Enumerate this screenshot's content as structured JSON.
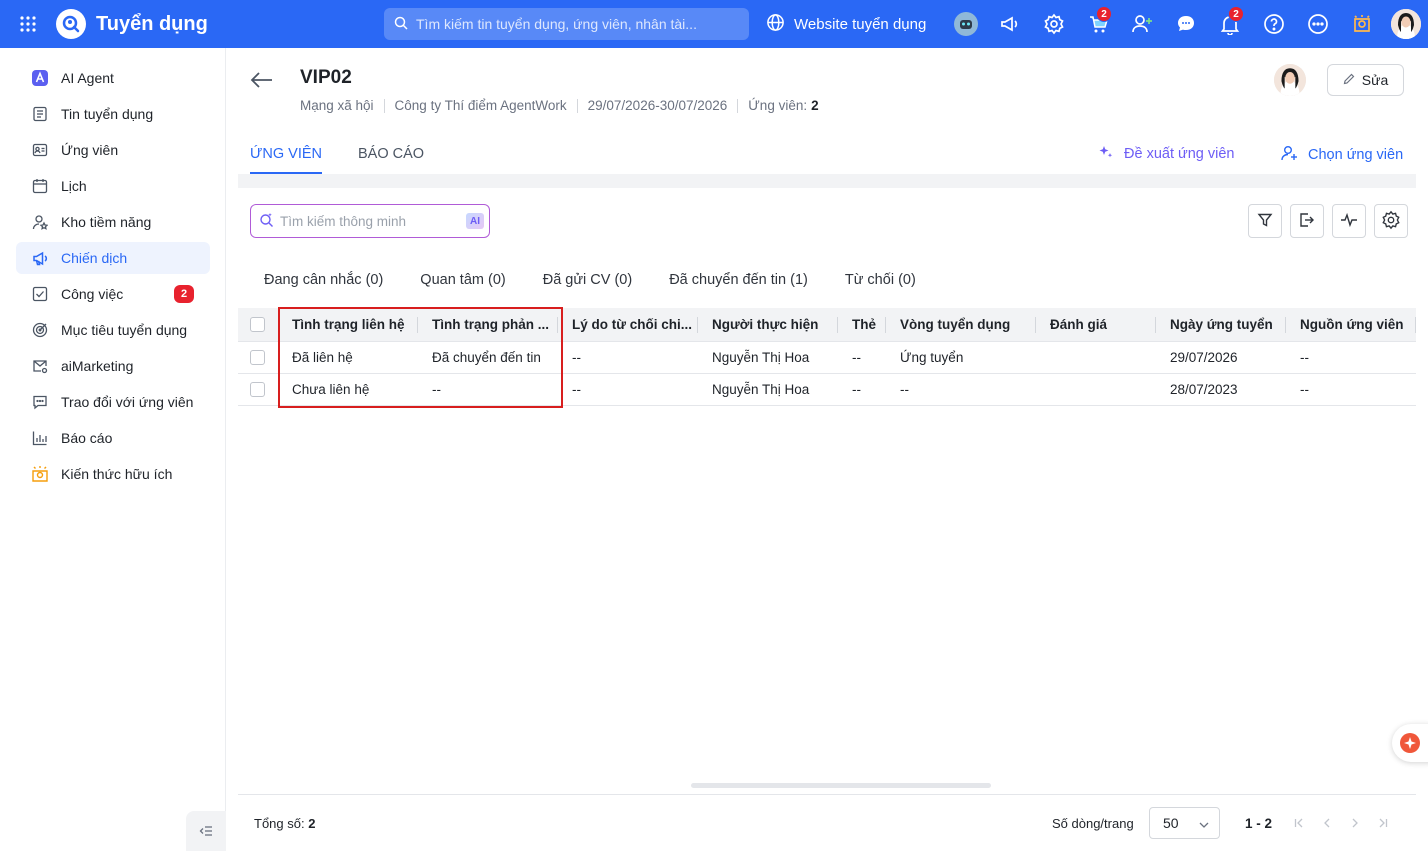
{
  "app": {
    "title": "Tuyển dụng"
  },
  "search": {
    "placeholder": "Tìm kiếm tin tuyển dụng, ứng viên, nhân tài..."
  },
  "topbar": {
    "website_label": "Website tuyển dụng",
    "cart_badge": "2",
    "notification_badge": "2"
  },
  "sidebar": {
    "items": [
      {
        "label": "AI Agent",
        "icon": "ai-agent-icon"
      },
      {
        "label": "Tin tuyển dụng",
        "icon": "document-icon"
      },
      {
        "label": "Ứng viên",
        "icon": "id-card-icon"
      },
      {
        "label": "Lịch",
        "icon": "calendar-icon"
      },
      {
        "label": "Kho tiềm năng",
        "icon": "user-star-icon"
      },
      {
        "label": "Chiến dịch",
        "icon": "megaphone-icon",
        "active": true
      },
      {
        "label": "Công việc",
        "icon": "checkbox-icon",
        "badge": "2"
      },
      {
        "label": "Mục tiêu tuyển dụng",
        "icon": "target-icon"
      },
      {
        "label": "aiMarketing",
        "icon": "mail-gear-icon"
      },
      {
        "label": "Trao đổi với ứng viên",
        "icon": "chat-icon"
      },
      {
        "label": "Báo cáo",
        "icon": "bar-chart-icon"
      },
      {
        "label": "Kiến thức hữu ích",
        "icon": "lightbulb-icon"
      }
    ]
  },
  "header": {
    "title": "VIP02",
    "channel": "Mạng xã hội",
    "company": "Công ty Thí điểm AgentWork",
    "date_range": "29/07/2026-30/07/2026",
    "candidates_label": "Ứng viên:",
    "candidates_count": "2",
    "edit_label": "Sửa"
  },
  "tabs": [
    {
      "label": "ỨNG VIÊN",
      "active": true
    },
    {
      "label": "BÁO CÁO",
      "active": false
    }
  ],
  "actions": {
    "suggest_label": "Đề xuất ứng viên",
    "choose_label": "Chọn ứng viên"
  },
  "smart_search": {
    "placeholder": "Tìm kiếm thông minh",
    "ai_tag": "AI"
  },
  "filters": [
    "Đang cân nhắc (0)",
    "Quan tâm (0)",
    "Đã gửi CV (0)",
    "Đã chuyển đến tin (1)",
    "Từ chối (0)"
  ],
  "table": {
    "columns": [
      "Tình trạng liên hệ",
      "Tình trạng phản ...",
      "Lý do từ chối chi...",
      "Người thực hiện",
      "Thẻ",
      "Vòng tuyển dụng",
      "Đánh giá",
      "Ngày ứng tuyển",
      "Nguồn ứng viên"
    ],
    "rows": [
      [
        "Đã liên hệ",
        "Đã chuyển đến tin",
        "--",
        "Nguyễn Thị Hoa",
        "--",
        "Ứng tuyển",
        "",
        "29/07/2026",
        "--"
      ],
      [
        "Chưa liên hệ",
        "--",
        "--",
        "Nguyễn Thị Hoa",
        "--",
        "--",
        "",
        "28/07/2023",
        "--"
      ]
    ]
  },
  "footer": {
    "total_label": "Tổng số:",
    "total_value": "2",
    "rows_per_page_label": "Số dòng/trang",
    "rows_per_page": "50",
    "range": "1 - 2"
  },
  "colors": {
    "primary": "#2a68f5",
    "highlight": "#d81e1e",
    "badge": "#e8222e",
    "ai": "#6d5df5"
  }
}
